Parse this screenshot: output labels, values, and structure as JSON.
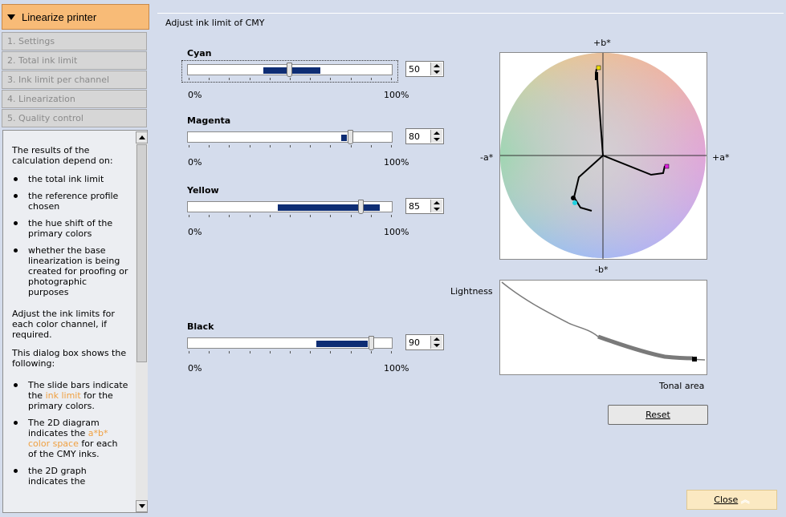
{
  "nav": {
    "header": "Linearize printer",
    "steps": [
      "1. Settings",
      "2. Total ink limit",
      "3. Ink limit per channel",
      "4. Linearization",
      "5. Quality control"
    ]
  },
  "help": {
    "intro": "The results of the calculation depend on:",
    "depends": [
      "the total ink limit",
      "the reference profile chosen",
      "the hue shift of the primary colors",
      "whether the base linearization is being created for proofing or photographic purposes"
    ],
    "adjust": "Adjust the ink limits for each color channel, if required.",
    "shows": "This dialog box shows the following:",
    "items": [
      {
        "pre": "The slide bars indicate the ",
        "link": "ink limit",
        "post": " for the primary colors."
      },
      {
        "pre": "The 2D diagram indicates the ",
        "link": "a*b* color space",
        "post": " for each of the CMY inks."
      },
      {
        "pre": "the 2D graph indicates the",
        "link": "",
        "post": ""
      }
    ]
  },
  "main": {
    "title": "Adjust ink limit of CMY",
    "channels": [
      {
        "name": "Cyan",
        "value": "50",
        "fill_from": 0.37,
        "fill_to": 0.65,
        "thumb": 0.5
      },
      {
        "name": "Magenta",
        "value": "80",
        "fill_from": 0.75,
        "fill_to": 0.78,
        "thumb": 0.8
      },
      {
        "name": "Yellow",
        "value": "85",
        "fill_from": 0.44,
        "fill_to": 0.94,
        "thumb": 0.85
      },
      {
        "name": "Black",
        "value": "90",
        "fill_from": 0.63,
        "fill_to": 0.88,
        "thumb": 0.9
      }
    ],
    "min_label": "0%",
    "max_label": "100%"
  },
  "ab_diagram": {
    "top_label": "+b*",
    "bottom_label": "-b*",
    "left_label": "-a*",
    "right_label": "+a*"
  },
  "lightness": {
    "y_label": "Lightness",
    "x_label": "Tonal area"
  },
  "buttons": {
    "reset": "Reset",
    "close": "Close"
  },
  "colors": {
    "accent": "#f8bb77",
    "slider_fill": "#0e2d74"
  }
}
